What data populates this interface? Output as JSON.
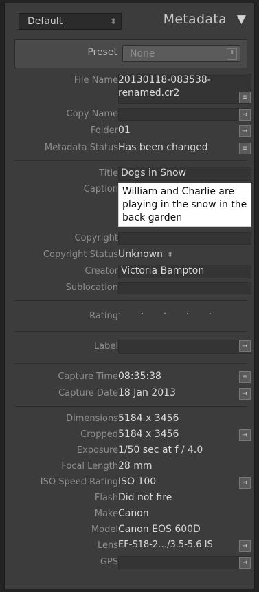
{
  "header": {
    "preset_select": "Default",
    "title": "Metadata",
    "collapse_glyph": "▼"
  },
  "preset": {
    "label": "Preset",
    "value": "None"
  },
  "fields": {
    "file_name": {
      "label": "File Name",
      "value_line1": "20130118-083538-",
      "value_line2": "renamed.cr2"
    },
    "copy_name": {
      "label": "Copy Name",
      "value": ""
    },
    "folder": {
      "label": "Folder",
      "value": "01"
    },
    "metadata_status": {
      "label": "Metadata Status",
      "value": "Has been changed"
    },
    "title": {
      "label": "Title",
      "value": "Dogs in Snow"
    },
    "caption": {
      "label": "Caption",
      "value": "William and Charlie are playing in the snow in the back garden"
    },
    "copyright": {
      "label": "Copyright",
      "value": ""
    },
    "copyright_status": {
      "label": "Copyright Status",
      "value": "Unknown"
    },
    "creator": {
      "label": "Creator",
      "value": "Victoria Bampton"
    },
    "sublocation": {
      "label": "Sublocation",
      "value": ""
    },
    "rating": {
      "label": "Rating",
      "value": "· · · · ·"
    },
    "label": {
      "label": "Label",
      "value": ""
    },
    "capture_time": {
      "label": "Capture Time",
      "value": "08:35:38"
    },
    "capture_date": {
      "label": "Capture Date",
      "value": "18 Jan 2013"
    },
    "dimensions": {
      "label": "Dimensions",
      "value": "5184 x 3456"
    },
    "cropped": {
      "label": "Cropped",
      "value": "5184 x 3456"
    },
    "exposure": {
      "label": "Exposure",
      "value": "1/50 sec at f / 4.0"
    },
    "focal_length": {
      "label": "Focal Length",
      "value": "28 mm"
    },
    "iso": {
      "label": "ISO Speed Rating",
      "value": "ISO 100"
    },
    "flash": {
      "label": "Flash",
      "value": "Did not fire"
    },
    "make": {
      "label": "Make",
      "value": "Canon"
    },
    "model": {
      "label": "Model",
      "value": "Canon EOS 600D"
    },
    "lens": {
      "label": "Lens",
      "value": "EF-S18-2…/3.5-5.6 IS"
    },
    "gps": {
      "label": "GPS",
      "value": ""
    }
  },
  "colors": {
    "panel_bg": "#3c3c3c",
    "caption_bg": "#ffffff",
    "preset_box_bg": "#4a4a4a"
  }
}
